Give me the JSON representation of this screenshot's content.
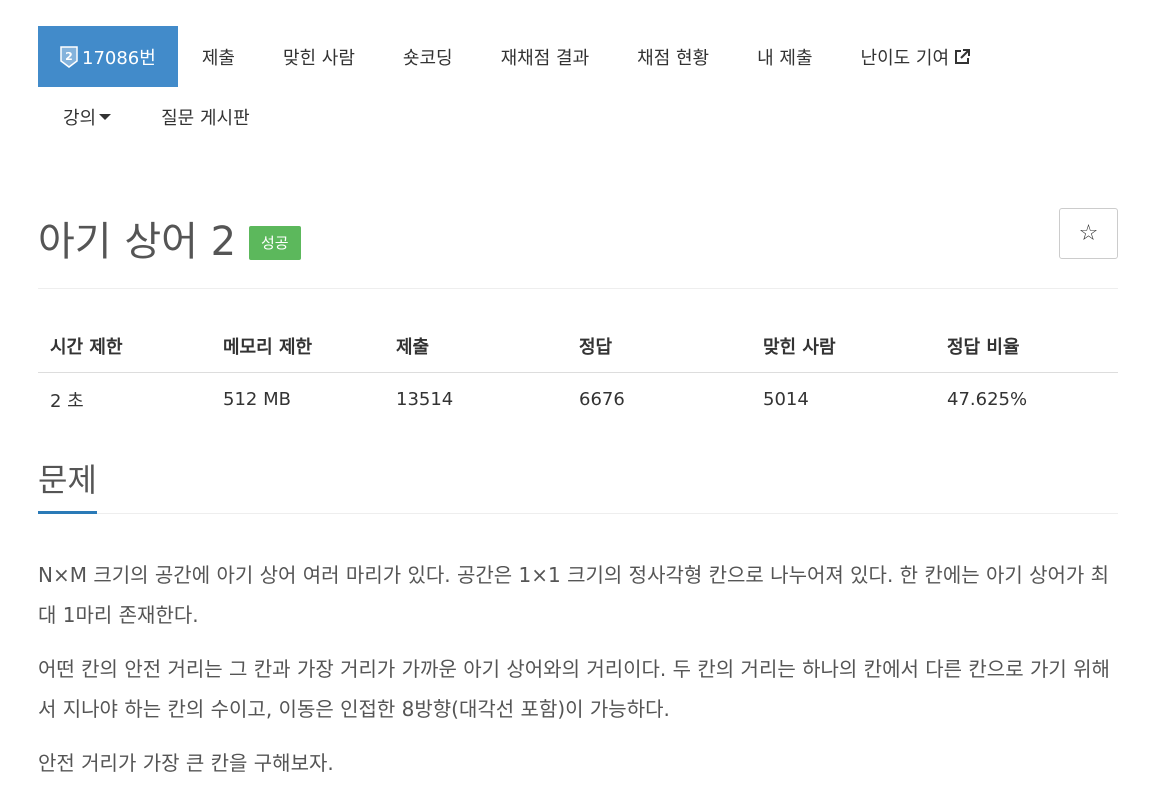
{
  "nav": {
    "tabs_row1": [
      {
        "label": "17086번",
        "active": true
      },
      {
        "label": "제출"
      },
      {
        "label": "맞힌 사람"
      },
      {
        "label": "숏코딩"
      },
      {
        "label": "재채점 결과"
      },
      {
        "label": "채점 현황"
      },
      {
        "label": "내 제출"
      },
      {
        "label": "난이도 기여"
      }
    ],
    "tabs_row2": [
      {
        "label": "강의"
      },
      {
        "label": "질문 게시판"
      }
    ]
  },
  "problem": {
    "title": "아기 상어 2",
    "status": "성공",
    "star": "☆"
  },
  "stats": {
    "headers": [
      "시간 제한",
      "메모리 제한",
      "제출",
      "정답",
      "맞힌 사람",
      "정답 비율"
    ],
    "values": [
      "2 초",
      "512 MB",
      "13514",
      "6676",
      "5014",
      "47.625%"
    ]
  },
  "section": {
    "heading": "문제"
  },
  "description": {
    "paragraphs": [
      "N×M 크기의 공간에 아기 상어 여러 마리가 있다. 공간은 1×1 크기의 정사각형 칸으로 나누어져 있다. 한 칸에는 아기 상어가 최대 1마리 존재한다.",
      "어떤 칸의 안전 거리는 그 칸과 가장 거리가 가까운 아기 상어와의 거리이다. 두 칸의 거리는 하나의 칸에서 다른 칸으로 가기 위해서 지나야 하는 칸의 수이고, 이동은 인접한 8방향(대각선 포함)이 가능하다.",
      "안전 거리가 가장 큰 칸을 구해보자."
    ]
  },
  "colors": {
    "active_tab": "#428bca",
    "success": "#5cb85c",
    "heading_underline": "#2a7ab7"
  }
}
